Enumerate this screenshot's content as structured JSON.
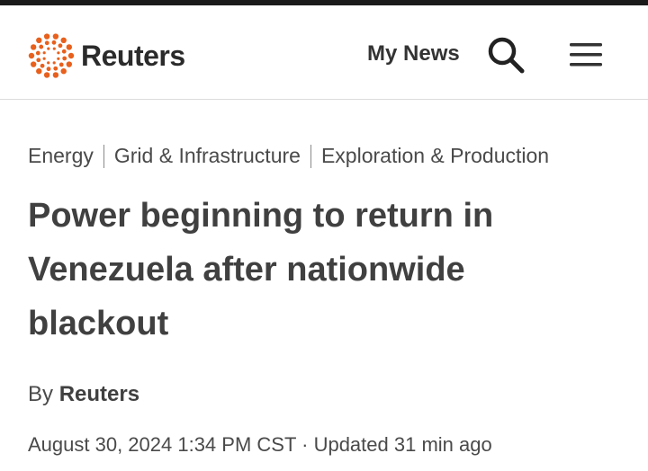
{
  "header": {
    "brand": "Reuters",
    "my_news_label": "My News",
    "logo_icon": "reuters-dots-logo-icon",
    "search_icon": "search-icon",
    "menu_icon": "hamburger-menu-icon",
    "brand_color": "#e8601c"
  },
  "article": {
    "categories": [
      "Energy",
      "Grid & Infrastructure",
      "Exploration & Production"
    ],
    "headline": "Power beginning to return in Venezuela after nationwide blackout",
    "byline_prefix": "By",
    "author": "Reuters",
    "date": "August 30, 2024 1:34 PM CST",
    "separator": "·",
    "updated": "Updated 31 min ago"
  }
}
